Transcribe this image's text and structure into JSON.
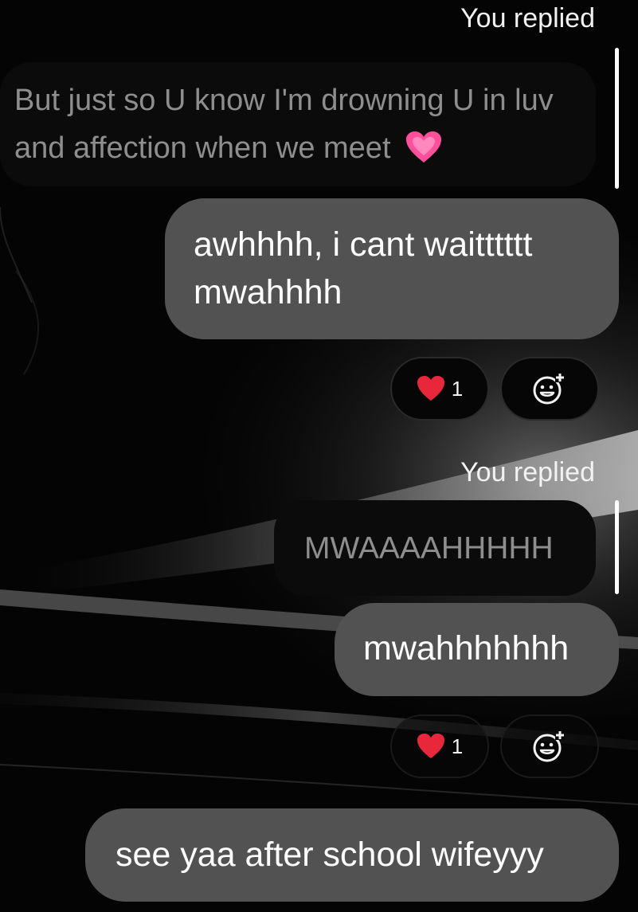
{
  "thread": {
    "reply_label_1": "You replied",
    "quoted_message_1": "But just so U know I'm drowning U in luv and affection when we meet",
    "quoted_emoji_icon_1": "growing-heart-icon",
    "message_1": "awhhhh, i cant waitttttt mwahhhh",
    "message_1_reaction": {
      "emoji": "red-heart-icon",
      "count": "1"
    },
    "reply_label_2": "You replied",
    "quoted_message_2": "MWAAAAHHHHH",
    "message_2": "mwahhhhhhh",
    "message_2_reaction": {
      "emoji": "red-heart-icon",
      "count": "1"
    },
    "message_3": "see yaa after school wifeyyy"
  },
  "icons": {
    "add_reaction": "add-reaction-smiley-icon"
  },
  "colors": {
    "background": "#050505",
    "sent_bubble": "#525252",
    "quoted_bubble": "#0b0b0b",
    "quoted_text": "#8e8e8e",
    "heart": "#e8283a",
    "growing_heart": "#ff4f9a"
  }
}
